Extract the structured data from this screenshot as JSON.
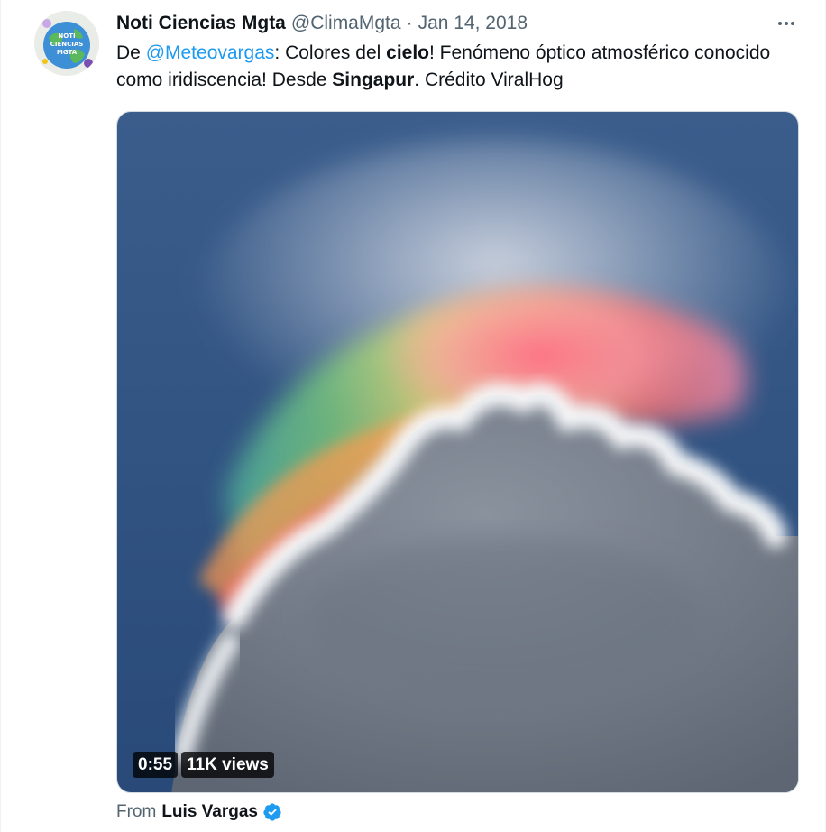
{
  "author": {
    "display_name": "Noti Ciencias Mgta",
    "handle": "@ClimaMgta",
    "separator": "·",
    "date": "Jan 14, 2018",
    "avatar_text": [
      "NOTI",
      "CIENCIAS",
      "MGTA"
    ]
  },
  "tweet": {
    "text_parts": {
      "prefix": "De ",
      "mention": "@Meteovargas",
      "part1": ": Colores del ",
      "bold1": "cielo",
      "part2": "! Fenómeno óptico atmosférico conocido como iridiscencia! Desde ",
      "bold2": "Singapur",
      "part3": ". Crédito ViralHog"
    }
  },
  "media": {
    "type": "video",
    "duration": "0:55",
    "views": "11K views"
  },
  "source": {
    "label": "From",
    "name": "Luis Vargas",
    "verified": true
  },
  "icons": {
    "more": "more-horizontal-icon",
    "verified": "verified-badge-icon"
  },
  "colors": {
    "link": "#1d9bf0",
    "secondary_text": "#536471",
    "primary_text": "#0f1419",
    "verified": "#1d9bf0"
  }
}
